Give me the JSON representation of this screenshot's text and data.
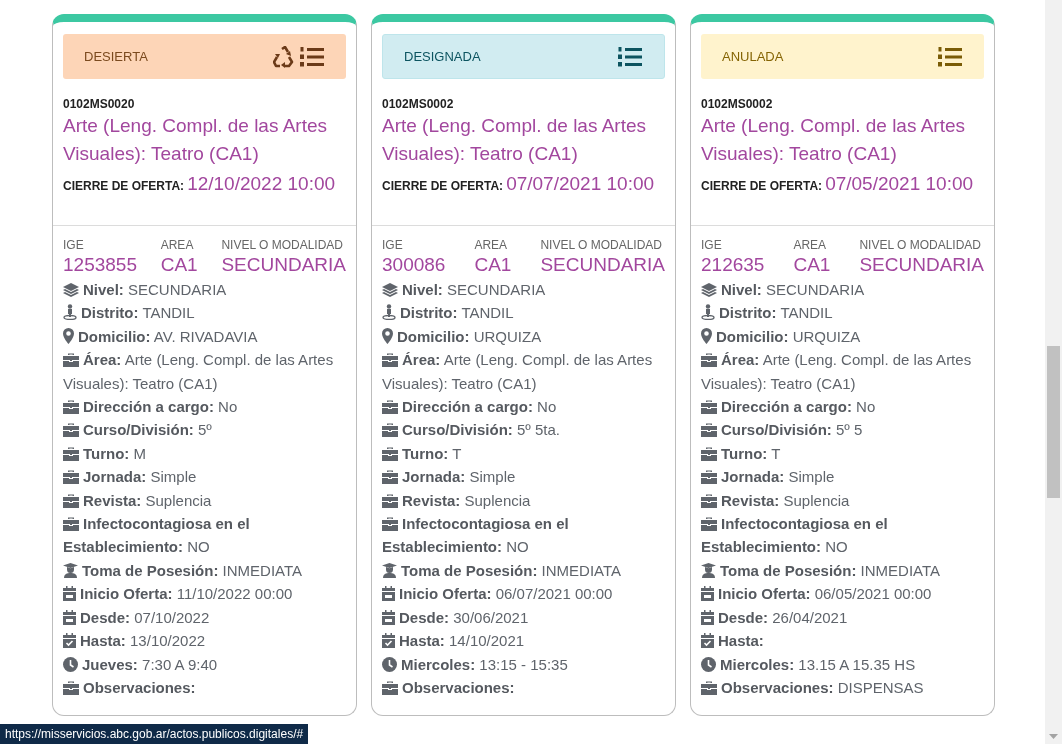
{
  "cards": [
    {
      "status": {
        "label": "DESIERTA",
        "kind": "desierta"
      },
      "actions": [
        {
          "kind": "recycle"
        },
        {
          "kind": "list"
        }
      ],
      "code": "0102MS0020",
      "title": "Arte (Leng. Compl. de las Artes Visuales): Teatro (CA1)",
      "closing_label": "CIERRE DE OFERTA:",
      "closing_value": "12/10/2022 10:00",
      "summary": [
        {
          "label": "IGE",
          "value": "1253855"
        },
        {
          "label": "AREA",
          "value": "CA1"
        },
        {
          "label": "NIVEL O MODALIDAD",
          "value": "SECUNDARIA"
        }
      ],
      "details": [
        {
          "kind": "layers",
          "label": "Nivel:",
          "value": "SECUNDARIA"
        },
        {
          "kind": "person",
          "label": "Distrito:",
          "value": "TANDIL"
        },
        {
          "kind": "marker",
          "label": "Domicilio:",
          "value": "AV. RIVADAVIA"
        },
        {
          "kind": "briefcase",
          "label": "Área:",
          "value": "Arte (Leng. Compl. de las Artes Visuales): Teatro (CA1)"
        },
        {
          "kind": "briefcase",
          "label": "Dirección a cargo:",
          "value": "No"
        },
        {
          "kind": "briefcase",
          "label": "Curso/División:",
          "value": "5º"
        },
        {
          "kind": "briefcase",
          "label": "Turno:",
          "value": "M"
        },
        {
          "kind": "briefcase",
          "label": "Jornada:",
          "value": "Simple"
        },
        {
          "kind": "briefcase",
          "label": "Revista:",
          "value": "Suplencia"
        },
        {
          "kind": "briefcase",
          "label": "Infectocontagiosa en el Establecimiento:",
          "value": "NO"
        },
        {
          "kind": "graduate",
          "label": "Toma de Posesión:",
          "value": "INMEDIATA"
        },
        {
          "kind": "calendar",
          "label": "Inicio Oferta:",
          "value": "11/10/2022 00:00"
        },
        {
          "kind": "calendar",
          "label": "Desde:",
          "value": "07/10/2022"
        },
        {
          "kind": "calendar-check",
          "label": "Hasta:",
          "value": "13/10/2022"
        },
        {
          "kind": "clock",
          "label": "Jueves:",
          "value": "7:30 A 9:40"
        },
        {
          "kind": "briefcase",
          "label": "Observaciones:"
        }
      ]
    },
    {
      "status": {
        "label": "DESIGNADA",
        "kind": "designada"
      },
      "actions": [
        {
          "kind": "list"
        }
      ],
      "code": "0102MS0002",
      "title": "Arte (Leng. Compl. de las Artes Visuales): Teatro (CA1)",
      "closing_label": "CIERRE DE OFERTA:",
      "closing_value": "07/07/2021 10:00",
      "summary": [
        {
          "label": "IGE",
          "value": "300086"
        },
        {
          "label": "AREA",
          "value": "CA1"
        },
        {
          "label": "NIVEL O MODALIDAD",
          "value": "SECUNDARIA"
        }
      ],
      "details": [
        {
          "kind": "layers",
          "label": "Nivel:",
          "value": "SECUNDARIA"
        },
        {
          "kind": "person",
          "label": "Distrito:",
          "value": "TANDIL"
        },
        {
          "kind": "marker",
          "label": "Domicilio:",
          "value": "URQUIZA"
        },
        {
          "kind": "briefcase",
          "label": "Área:",
          "value": "Arte (Leng. Compl. de las Artes Visuales): Teatro (CA1)"
        },
        {
          "kind": "briefcase",
          "label": "Dirección a cargo:",
          "value": "No"
        },
        {
          "kind": "briefcase",
          "label": "Curso/División:",
          "value": "5º 5ta."
        },
        {
          "kind": "briefcase",
          "label": "Turno:",
          "value": "T"
        },
        {
          "kind": "briefcase",
          "label": "Jornada:",
          "value": "Simple"
        },
        {
          "kind": "briefcase",
          "label": "Revista:",
          "value": "Suplencia"
        },
        {
          "kind": "briefcase",
          "label": "Infectocontagiosa en el Establecimiento:",
          "value": "NO"
        },
        {
          "kind": "graduate",
          "label": "Toma de Posesión:",
          "value": "INMEDIATA"
        },
        {
          "kind": "calendar",
          "label": "Inicio Oferta:",
          "value": "06/07/2021 00:00"
        },
        {
          "kind": "calendar",
          "label": "Desde:",
          "value": "30/06/2021"
        },
        {
          "kind": "calendar-check",
          "label": "Hasta:",
          "value": "14/10/2021"
        },
        {
          "kind": "clock",
          "label": "Miercoles:",
          "value": "13:15 - 15:35"
        },
        {
          "kind": "briefcase",
          "label": "Observaciones:"
        }
      ]
    },
    {
      "status": {
        "label": "ANULADA",
        "kind": "anulada"
      },
      "actions": [
        {
          "kind": "list"
        }
      ],
      "code": "0102MS0002",
      "title": "Arte (Leng. Compl. de las Artes Visuales): Teatro (CA1)",
      "closing_label": "CIERRE DE OFERTA:",
      "closing_value": "07/05/2021 10:00",
      "summary": [
        {
          "label": "IGE",
          "value": "212635"
        },
        {
          "label": "AREA",
          "value": "CA1"
        },
        {
          "label": "NIVEL O MODALIDAD",
          "value": "SECUNDARIA"
        }
      ],
      "details": [
        {
          "kind": "layers",
          "label": "Nivel:",
          "value": "SECUNDARIA"
        },
        {
          "kind": "person",
          "label": "Distrito:",
          "value": "TANDIL"
        },
        {
          "kind": "marker",
          "label": "Domicilio:",
          "value": "URQUIZA"
        },
        {
          "kind": "briefcase",
          "label": "Área:",
          "value": "Arte (Leng. Compl. de las Artes Visuales): Teatro (CA1)"
        },
        {
          "kind": "briefcase",
          "label": "Dirección a cargo:",
          "value": "No"
        },
        {
          "kind": "briefcase",
          "label": "Curso/División:",
          "value": "5º 5"
        },
        {
          "kind": "briefcase",
          "label": "Turno:",
          "value": "T"
        },
        {
          "kind": "briefcase",
          "label": "Jornada:",
          "value": "Simple"
        },
        {
          "kind": "briefcase",
          "label": "Revista:",
          "value": "Suplencia"
        },
        {
          "kind": "briefcase",
          "label": "Infectocontagiosa en el Establecimiento:",
          "value": "NO"
        },
        {
          "kind": "graduate",
          "label": "Toma de Posesión:",
          "value": "INMEDIATA"
        },
        {
          "kind": "calendar",
          "label": "Inicio Oferta:",
          "value": "06/05/2021 00:00"
        },
        {
          "kind": "calendar",
          "label": "Desde:",
          "value": "26/04/2021"
        },
        {
          "kind": "calendar-check",
          "label": "Hasta:"
        },
        {
          "kind": "clock",
          "label": "Miercoles:",
          "value": "13.15 A 15.35 HS"
        },
        {
          "kind": "briefcase",
          "label": "Observaciones:",
          "value": "DISPENSAS"
        }
      ]
    }
  ],
  "status_bar": {
    "url": "https://misservicios.abc.gob.ar/actos.publicos.digitales/#"
  }
}
